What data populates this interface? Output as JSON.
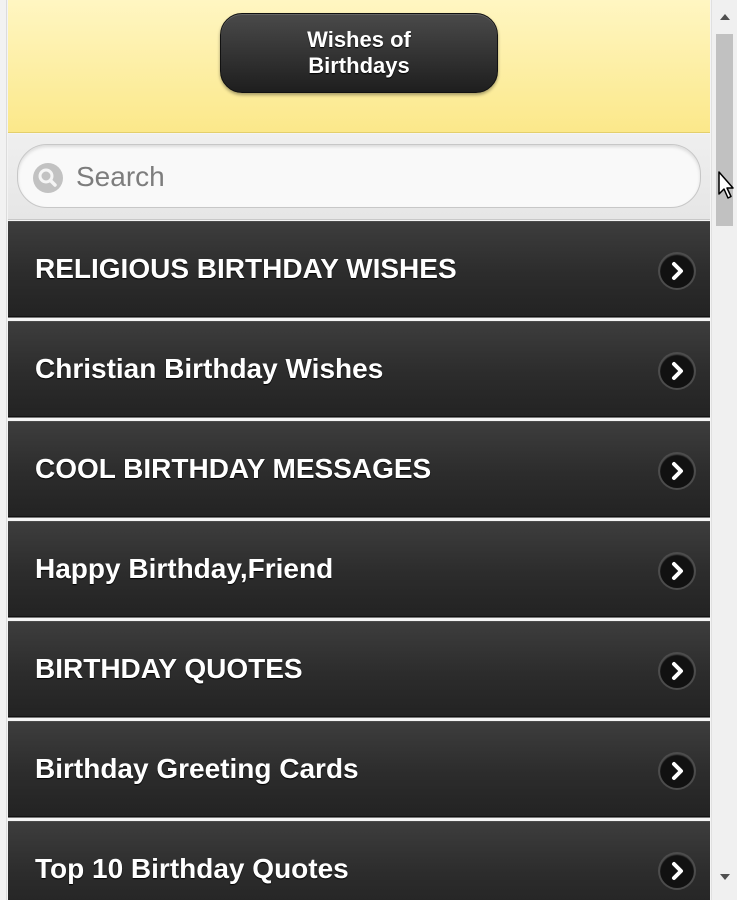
{
  "header": {
    "title": "Wishes of Birthdays",
    "background_color": "#fbe88a"
  },
  "search": {
    "placeholder": "Search",
    "value": ""
  },
  "menu": {
    "items": [
      {
        "label": "RELIGIOUS BIRTHDAY WISHES"
      },
      {
        "label": "Christian Birthday Wishes"
      },
      {
        "label": "COOL BIRTHDAY MESSAGES"
      },
      {
        "label": "Happy Birthday,Friend"
      },
      {
        "label": "BIRTHDAY QUOTES"
      },
      {
        "label": "Birthday Greeting Cards"
      },
      {
        "label": "Top 10 Birthday Quotes"
      }
    ],
    "item_icon": "chevron-right-icon",
    "item_background_color": "#2c2c2c"
  },
  "icons": {
    "search": "search-icon",
    "scroll_up": "scroll-up-arrow-icon",
    "scroll_down": "scroll-down-arrow-icon",
    "cursor": "mouse-pointer-icon"
  }
}
